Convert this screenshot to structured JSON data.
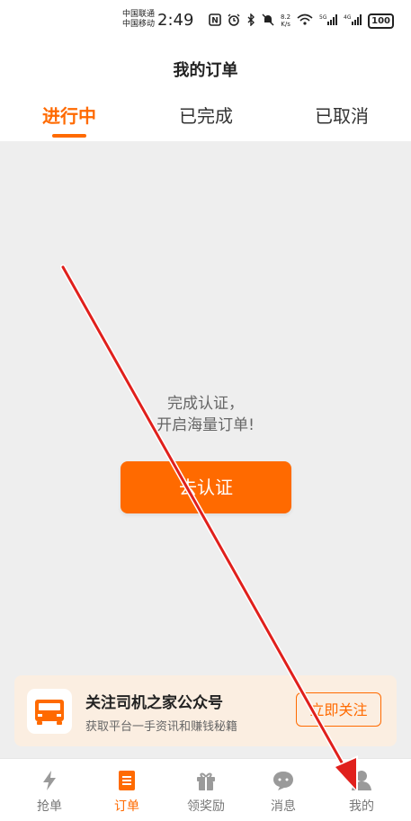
{
  "status_bar": {
    "carrier1": "中国联通",
    "carrier2": "中国移动",
    "time": "2:49",
    "speed_value": "8.2",
    "speed_unit": "K/s",
    "battery": "100"
  },
  "header": {
    "title": "我的订单"
  },
  "tabs": [
    {
      "label": "进行中",
      "active": true
    },
    {
      "label": "已完成",
      "active": false
    },
    {
      "label": "已取消",
      "active": false
    }
  ],
  "empty_state": {
    "line1": "完成认证，",
    "line2": "开启海量订单!",
    "button_label": "去认证"
  },
  "follow_card": {
    "title": "关注司机之家公众号",
    "subtitle": "获取平台一手资讯和赚钱秘籍",
    "button_label": "立即关注",
    "icon": "truck-icon"
  },
  "bottom_nav": [
    {
      "label": "抢单",
      "icon": "lightning-icon",
      "active": false
    },
    {
      "label": "订单",
      "icon": "order-list-icon",
      "active": true
    },
    {
      "label": "领奖励",
      "icon": "gift-icon",
      "active": false
    },
    {
      "label": "消息",
      "icon": "chat-bubble-icon",
      "active": false
    },
    {
      "label": "我的",
      "icon": "person-icon",
      "active": false
    }
  ],
  "colors": {
    "accent": "#ff6a00",
    "background": "#eeeeee",
    "card": "#fbeee1",
    "annotation_arrow": "#e0201c"
  }
}
